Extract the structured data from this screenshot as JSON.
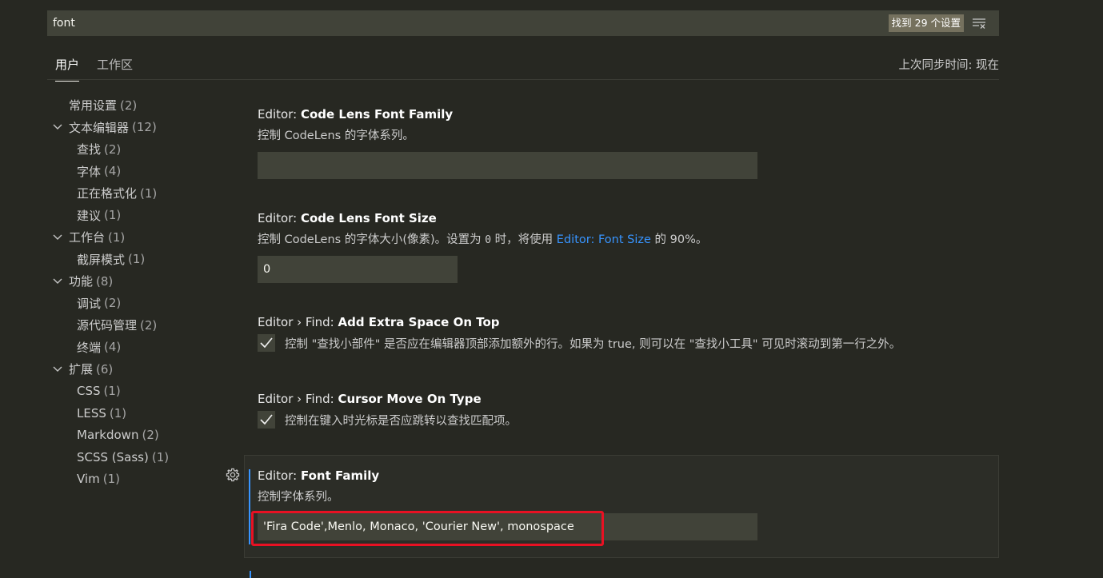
{
  "search": {
    "value": "font",
    "result_count": "找到 29 个设置",
    "clear_icon": "clear-filter-icon"
  },
  "tabs": [
    {
      "label": "用户",
      "active": true
    },
    {
      "label": "工作区",
      "active": false
    }
  ],
  "sync_status": "上次同步时间: 现在",
  "toc": [
    {
      "label": "常用设置",
      "count": "(2)",
      "level": 0,
      "group": false
    },
    {
      "label": "文本编辑器",
      "count": "(12)",
      "level": 0,
      "group": true
    },
    {
      "label": "查找",
      "count": "(2)",
      "level": 1
    },
    {
      "label": "字体",
      "count": "(4)",
      "level": 1
    },
    {
      "label": "正在格式化",
      "count": "(1)",
      "level": 1
    },
    {
      "label": "建议",
      "count": "(1)",
      "level": 1
    },
    {
      "label": "工作台",
      "count": "(1)",
      "level": 0,
      "group": true
    },
    {
      "label": "截屏模式",
      "count": "(1)",
      "level": 1
    },
    {
      "label": "功能",
      "count": "(8)",
      "level": 0,
      "group": true
    },
    {
      "label": "调试",
      "count": "(2)",
      "level": 1
    },
    {
      "label": "源代码管理",
      "count": "(2)",
      "level": 1
    },
    {
      "label": "终端",
      "count": "(4)",
      "level": 1
    },
    {
      "label": "扩展",
      "count": "(6)",
      "level": 0,
      "group": true
    },
    {
      "label": "CSS",
      "count": "(1)",
      "level": 1
    },
    {
      "label": "LESS",
      "count": "(1)",
      "level": 1
    },
    {
      "label": "Markdown",
      "count": "(2)",
      "level": 1
    },
    {
      "label": "SCSS (Sass)",
      "count": "(1)",
      "level": 1
    },
    {
      "label": "Vim",
      "count": "(1)",
      "level": 1
    }
  ],
  "settings": {
    "code_lens_font_family": {
      "category": "Editor: ",
      "name": "Code Lens Font Family",
      "description": "控制 CodeLens 的字体系列。",
      "value": ""
    },
    "code_lens_font_size": {
      "category": "Editor: ",
      "name": "Code Lens Font Size",
      "desc_part1": "控制 CodeLens 的字体大小(像素)。设置为 ",
      "desc_code": "0",
      "desc_part2": " 时，将使用 ",
      "desc_link": "Editor: Font Size",
      "desc_part3": " 的 90%。",
      "value": "0"
    },
    "find_add_extra_space": {
      "category": "Editor › Find: ",
      "name": "Add Extra Space On Top",
      "description": "控制 \"查找小部件\" 是否应在编辑器顶部添加额外的行。如果为 true, 则可以在 \"查找小工具\" 可见时滚动到第一行之外。",
      "checked": true
    },
    "find_cursor_move": {
      "category": "Editor › Find: ",
      "name": "Cursor Move On Type",
      "description": "控制在键入时光标是否应跳转以查找匹配项。",
      "checked": true
    },
    "font_family": {
      "category": "Editor: ",
      "name": "Font Family",
      "description": "控制字体系列。",
      "value": "'Fira Code',Menlo, Monaco, 'Courier New', monospace"
    }
  },
  "colors": {
    "background": "#272822",
    "input_bg": "#414339",
    "link": "#3794ff",
    "highlight_border": "#e81123"
  }
}
